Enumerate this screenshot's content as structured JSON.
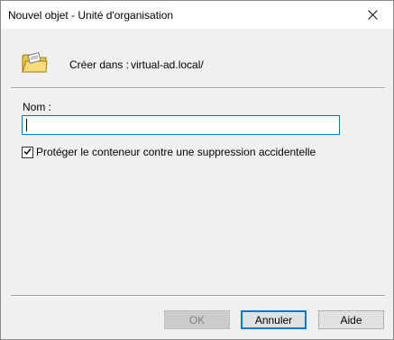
{
  "window": {
    "title": "Nouvel objet - Unité d'organisation",
    "close_icon": "close-icon"
  },
  "header": {
    "icon": "organizational-unit-icon",
    "create_label": "Créer dans :",
    "create_path": "virtual-ad.local/"
  },
  "form": {
    "name_label": "Nom :",
    "name_value": "",
    "protect_checked": true,
    "protect_label": "Protéger le conteneur contre une suppression accidentelle"
  },
  "buttons": {
    "ok_label": "OK",
    "ok_enabled": false,
    "cancel_label": "Annuler",
    "help_label": "Aide"
  },
  "colors": {
    "focus_accent": "#0078d7",
    "dialog_background": "#f0f0f0"
  }
}
